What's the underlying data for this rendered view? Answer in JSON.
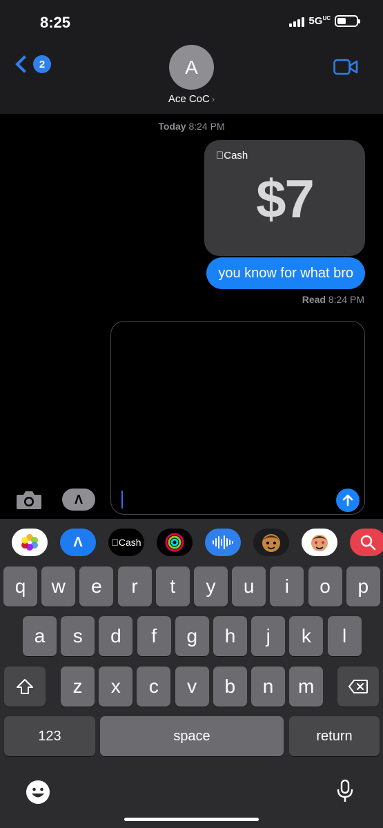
{
  "status": {
    "time": "8:25",
    "network": "5G",
    "network_sub": "UC"
  },
  "header": {
    "back_count": "2",
    "avatar_initial": "A",
    "contact_name": "Ace CoC",
    "contact_chevron": "›"
  },
  "messages": {
    "timestamp_day": "Today",
    "timestamp_time": "8:24 PM",
    "cash_logo": "Cash",
    "cash_amount": "$7",
    "text": "you know for what bro",
    "read_label": "Read",
    "read_time": "8:24 PM"
  },
  "apps": [
    {
      "name": "photos-app",
      "label": ""
    },
    {
      "name": "app-store-app",
      "label": ""
    },
    {
      "name": "apple-cash-app",
      "label": "Cash"
    },
    {
      "name": "activity-app",
      "label": ""
    },
    {
      "name": "audio-message-app",
      "label": ""
    },
    {
      "name": "memoji-app",
      "label": ""
    },
    {
      "name": "memoji-stickers-app",
      "label": ""
    },
    {
      "name": "images-search-app",
      "label": ""
    }
  ],
  "keyboard": {
    "row1": [
      "q",
      "w",
      "e",
      "r",
      "t",
      "y",
      "u",
      "i",
      "o",
      "p"
    ],
    "row2": [
      "a",
      "s",
      "d",
      "f",
      "g",
      "h",
      "j",
      "k",
      "l"
    ],
    "row3": [
      "z",
      "x",
      "c",
      "v",
      "b",
      "n",
      "m"
    ],
    "numbers": "123",
    "space": "space",
    "return": "return"
  },
  "colors": {
    "accent": "#1a82f7",
    "background": "#000000",
    "bubble_gray": "#3a3a3c"
  },
  "icons": [
    "back-chevron-icon",
    "video-camera-icon",
    "camera-icon",
    "app-store-icon",
    "send-arrow-icon",
    "shift-icon",
    "delete-icon",
    "emoji-icon",
    "microphone-icon"
  ]
}
